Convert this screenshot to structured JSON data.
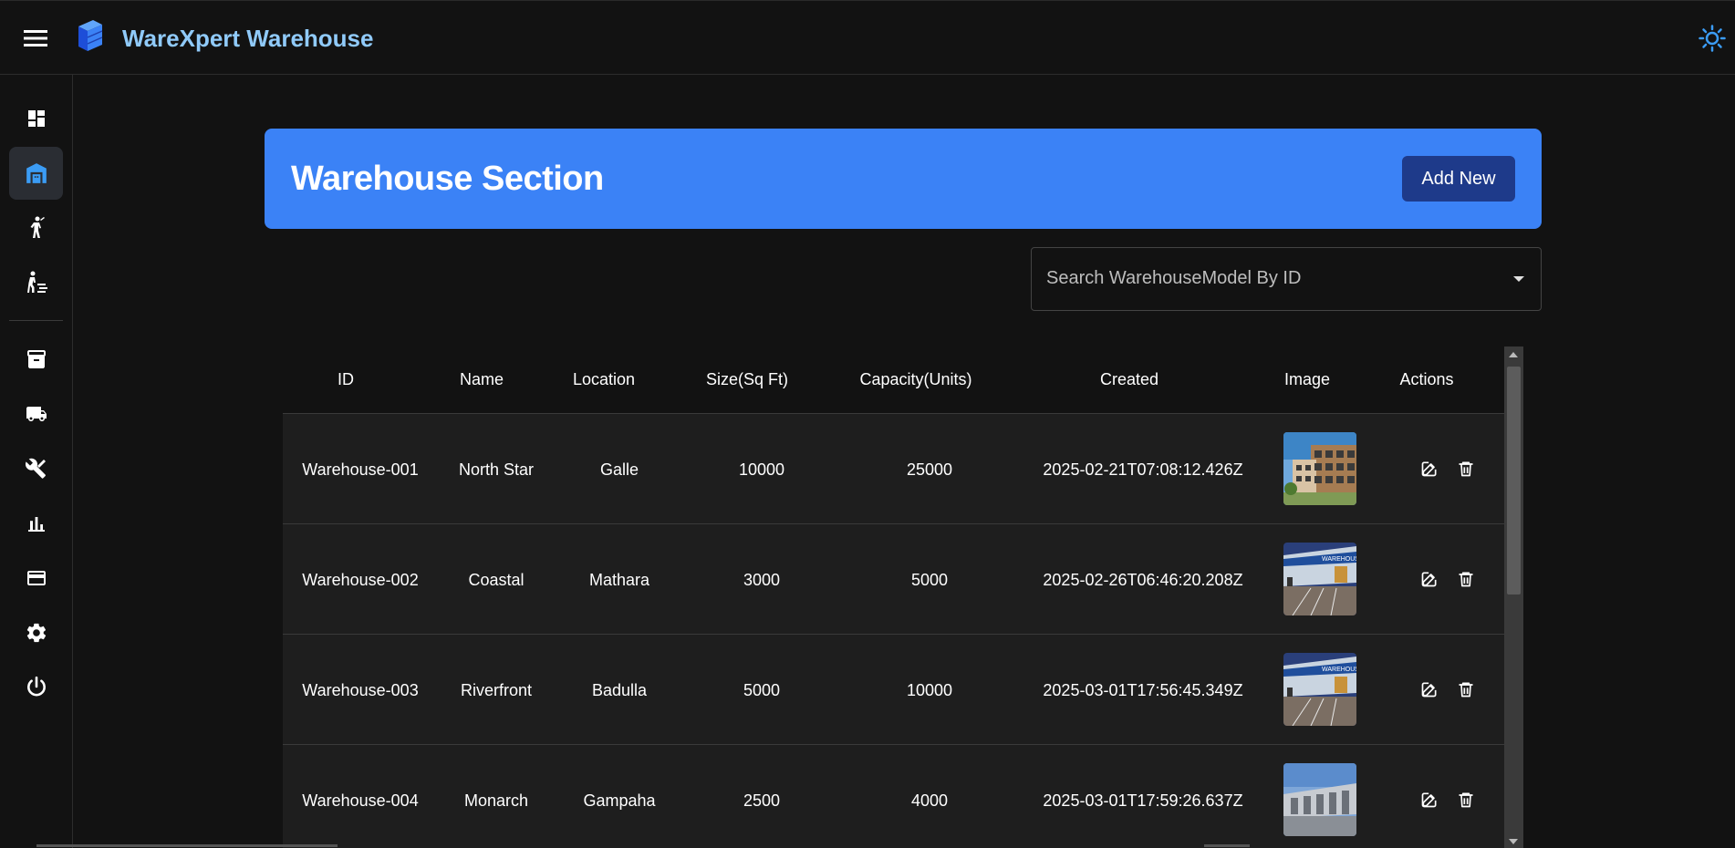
{
  "app": {
    "title": "WareXpert Warehouse",
    "accent": "#90caf9",
    "primary": "#3b82f6"
  },
  "sidebar": {
    "items": [
      {
        "icon": "dashboard-icon"
      },
      {
        "icon": "warehouse-icon",
        "active": true
      },
      {
        "icon": "staff-icon"
      },
      {
        "icon": "logistics-staff-icon"
      },
      {
        "icon": "inventory-icon"
      },
      {
        "icon": "truck-icon"
      },
      {
        "icon": "tools-icon"
      },
      {
        "icon": "bar-chart-icon"
      },
      {
        "icon": "credit-card-icon"
      },
      {
        "icon": "settings-icon"
      },
      {
        "icon": "power-icon"
      }
    ]
  },
  "header": {
    "title": "Warehouse Section",
    "add_label": "Add New"
  },
  "search": {
    "placeholder": "Search WarehouseModel By ID"
  },
  "table": {
    "columns": [
      "ID",
      "Name",
      "Location",
      "Size(Sq Ft)",
      "Capacity(Units)",
      "Created",
      "Image",
      "Actions"
    ],
    "rows": [
      {
        "id": "Warehouse-001",
        "name": "North Star",
        "location": "Galle",
        "size": "10000",
        "capacity": "25000",
        "created": "2025-02-21T07:08:12.426Z",
        "image": "office-building"
      },
      {
        "id": "Warehouse-002",
        "name": "Coastal",
        "location": "Mathara",
        "size": "3000",
        "capacity": "5000",
        "created": "2025-02-26T06:46:20.208Z",
        "image": "storefront"
      },
      {
        "id": "Warehouse-003",
        "name": "Riverfront",
        "location": "Badulla",
        "size": "5000",
        "capacity": "10000",
        "created": "2025-03-01T17:56:45.349Z",
        "image": "storefront"
      },
      {
        "id": "Warehouse-004",
        "name": "Monarch",
        "location": "Gampaha",
        "size": "2500",
        "capacity": "4000",
        "created": "2025-03-01T17:59:26.637Z",
        "image": "industrial-building"
      }
    ]
  }
}
